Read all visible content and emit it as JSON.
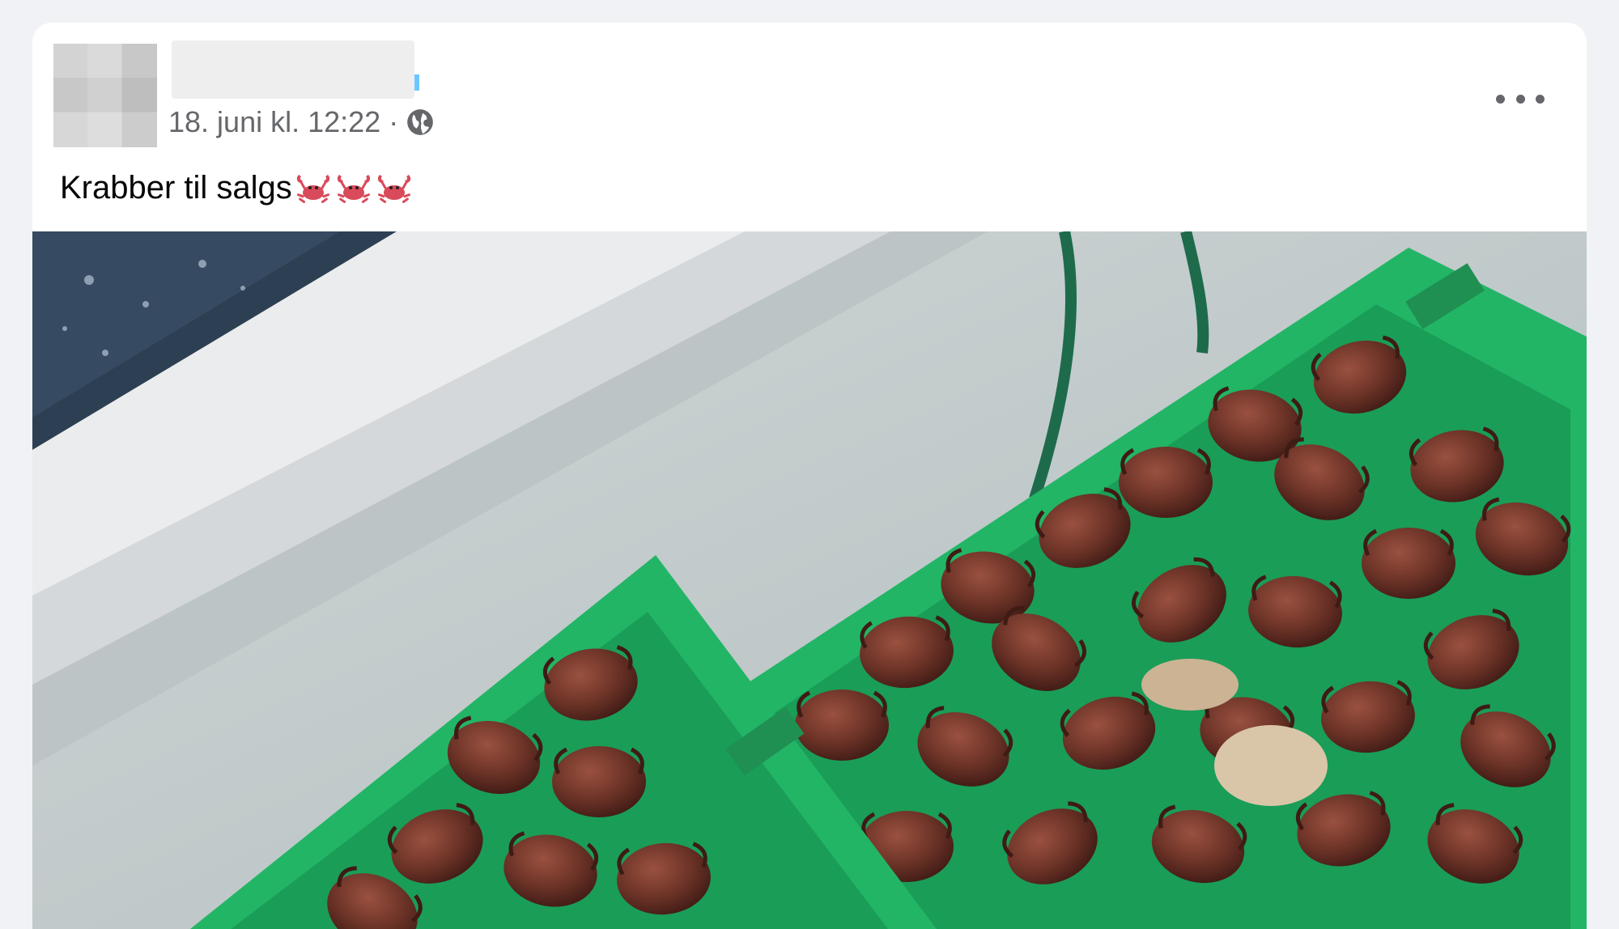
{
  "post": {
    "author_name": "",
    "timestamp": "18. juni kl. 12:22",
    "separator": "·",
    "privacy_icon": "globe-icon",
    "text": "Krabber til salgs",
    "emoji": [
      "crab-icon",
      "crab-icon",
      "crab-icon"
    ],
    "options_icon": "more-options-icon"
  },
  "colors": {
    "meta_text": "#65676b",
    "crate_green": "#22b566",
    "crab_brown": "#6e3428"
  }
}
